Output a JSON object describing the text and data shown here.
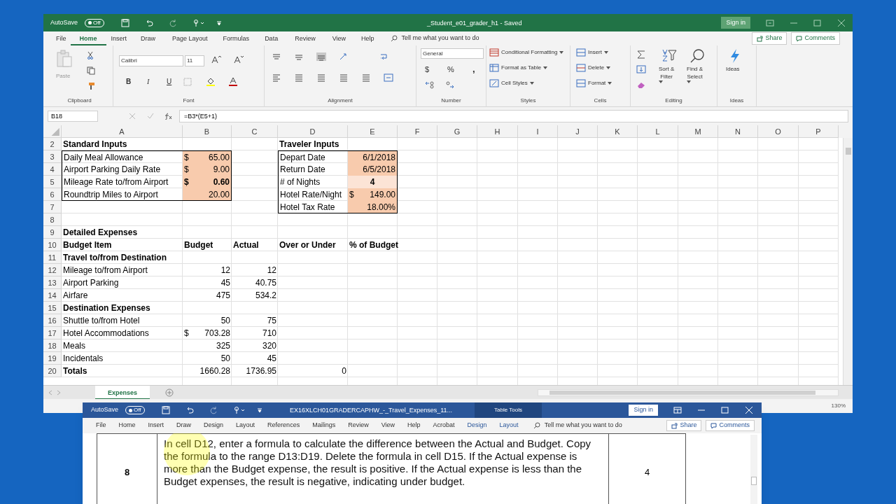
{
  "excel": {
    "title_bar": {
      "autosave_label": "AutoSave",
      "autosave": {
        "label": "Off",
        "on": false
      },
      "title": "_Student_e01_grader_h1  -  Saved",
      "sign_in": "Sign in"
    },
    "tabs": [
      {
        "label": "File",
        "selected": false
      },
      {
        "label": "Home",
        "selected": true
      },
      {
        "label": "Insert",
        "selected": false
      },
      {
        "label": "Draw",
        "selected": false
      },
      {
        "label": "Page Layout",
        "selected": false
      },
      {
        "label": "Formulas",
        "selected": false
      },
      {
        "label": "Data",
        "selected": false
      },
      {
        "label": "Review",
        "selected": false
      },
      {
        "label": "View",
        "selected": false
      },
      {
        "label": "Help",
        "selected": false
      }
    ],
    "tell_me": "Tell me what you want to do",
    "share": "Share",
    "comments": "Comments",
    "ribbon": {
      "paste": "Paste",
      "font_name": "Calibri",
      "font_size": "11",
      "bold": "B",
      "italic": "I",
      "underline": "U",
      "number_format": "General",
      "currency": "$",
      "percent": "%",
      "comma": ",",
      "styles": [
        "Conditional Formatting",
        "Format as Table",
        "Cell Styles"
      ],
      "cells": [
        "Insert",
        "Delete",
        "Format"
      ],
      "sort": [
        "Sort &",
        "Filter"
      ],
      "find": [
        "Find &",
        "Select"
      ],
      "ideas": "Ideas",
      "groups": [
        "Clipboard",
        "Font",
        "Alignment",
        "Number",
        "Styles",
        "Cells",
        "Editing",
        "Ideas"
      ]
    },
    "formula_bar": {
      "name_box": "B18",
      "formula": "=B3*(E5+1)"
    },
    "grid": {
      "columns": [
        "A",
        "B",
        "C",
        "D",
        "E",
        "F",
        "G",
        "H",
        "I",
        "J",
        "K",
        "L",
        "M",
        "N",
        "O",
        "P"
      ],
      "rows": [
        {
          "number": "2",
          "cells": [
            {
              "text": "Standard Inputs",
              "kind": "label",
              "bold": true
            },
            "",
            "",
            {
              "text": "Traveler Inputs",
              "kind": "label",
              "bold": true
            }
          ]
        },
        {
          "number": "3",
          "cells": [
            {
              "text": "Daily Meal Allowance",
              "kind": "label",
              "framed": true
            },
            {
              "symbol": "$",
              "text": "65.00",
              "kind": "number",
              "color": "#f8cbad",
              "framed": true
            },
            "",
            {
              "text": "Depart Date",
              "kind": "label",
              "framed": true
            },
            {
              "text": "6/1/2018",
              "kind": "number",
              "color": "#f8cbad",
              "framed": true
            }
          ]
        },
        {
          "number": "4",
          "cells": [
            {
              "text": "Airport Parking Daily Rate",
              "kind": "label",
              "framed": true
            },
            {
              "symbol": "$",
              "text": "9.00",
              "kind": "number",
              "color": "#f8cbad",
              "framed": true
            },
            "",
            {
              "text": "Return Date",
              "kind": "label",
              "framed": true
            },
            {
              "text": "6/5/2018",
              "kind": "number",
              "color": "#f8cbad",
              "framed": true
            }
          ]
        },
        {
          "number": "5",
          "cells": [
            {
              "text": "Mileage Rate to/from Airport",
              "kind": "label",
              "framed": true
            },
            {
              "symbol": "$",
              "text": "0.60",
              "kind": "number",
              "bold": true,
              "color": "#f8cbad",
              "framed": true
            },
            "",
            {
              "text": "# of Nights",
              "kind": "label",
              "framed": true
            },
            {
              "text": "4",
              "kind": "centered",
              "bold": true,
              "color": "#fce4d6",
              "framed": true
            }
          ]
        },
        {
          "number": "6",
          "cells": [
            {
              "text": "Roundtrip Miles to Airport",
              "kind": "label",
              "framed": true
            },
            {
              "text": "20.00",
              "kind": "number",
              "color": "#f8cbad",
              "framed": true
            },
            "",
            {
              "text": "Hotel Rate/Night",
              "kind": "label",
              "framed": true
            },
            {
              "symbol": "$",
              "text": "149.00",
              "kind": "number",
              "color": "#f8cbad",
              "framed": true
            }
          ]
        },
        {
          "number": "7",
          "cells": [
            "",
            "",
            "",
            {
              "text": "Hotel Tax Rate",
              "kind": "label",
              "framed": true
            },
            {
              "text": "18.00%",
              "kind": "number",
              "color": "#f8cbad",
              "framed": true
            }
          ]
        },
        {
          "number": "8",
          "cells": []
        },
        {
          "number": "9",
          "cells": [
            {
              "text": "Detailed Expenses",
              "kind": "label",
              "bold": true
            }
          ]
        },
        {
          "number": "10",
          "cells": [
            {
              "text": "Budget Item",
              "kind": "label",
              "bold": true
            },
            {
              "text": "Budget",
              "kind": "label",
              "bold": true
            },
            {
              "text": "Actual",
              "kind": "label",
              "bold": true
            },
            {
              "text": "Over or Under",
              "kind": "label",
              "bold": true
            },
            {
              "text": "% of Budget",
              "kind": "label",
              "bold": true
            }
          ]
        },
        {
          "number": "11",
          "cells": [
            {
              "text": "Travel to/from Destination",
              "kind": "label",
              "bold": true
            }
          ]
        },
        {
          "number": "12",
          "cells": [
            {
              "text": "Mileage to/from Airport",
              "kind": "label"
            },
            {
              "text": "12",
              "kind": "number"
            },
            {
              "text": "12",
              "kind": "number"
            }
          ]
        },
        {
          "number": "13",
          "cells": [
            {
              "text": "Airport Parking",
              "kind": "label"
            },
            {
              "text": "45",
              "kind": "number"
            },
            {
              "text": "40.75",
              "kind": "number"
            }
          ]
        },
        {
          "number": "14",
          "cells": [
            {
              "text": "Airfare",
              "kind": "label"
            },
            {
              "text": "475",
              "kind": "number"
            },
            {
              "text": "534.2",
              "kind": "number"
            }
          ]
        },
        {
          "number": "15",
          "cells": [
            {
              "text": "Destination Expenses",
              "kind": "label",
              "bold": true
            }
          ]
        },
        {
          "number": "16",
          "cells": [
            {
              "text": "Shuttle to/from Hotel",
              "kind": "label"
            },
            {
              "text": "50",
              "kind": "number"
            },
            {
              "text": "75",
              "kind": "number"
            }
          ]
        },
        {
          "number": "17",
          "cells": [
            {
              "text": "Hotel Accommodations",
              "kind": "label"
            },
            {
              "symbol": "$",
              "text": "703.28",
              "kind": "number"
            },
            {
              "text": "710",
              "kind": "number"
            }
          ]
        },
        {
          "number": "18",
          "cells": [
            {
              "text": "Meals",
              "kind": "label"
            },
            {
              "text": "325",
              "kind": "number"
            },
            {
              "text": "320",
              "kind": "number"
            }
          ]
        },
        {
          "number": "19",
          "cells": [
            {
              "text": "Incidentals",
              "kind": "label"
            },
            {
              "text": "50",
              "kind": "number"
            },
            {
              "text": "45",
              "kind": "number"
            }
          ]
        },
        {
          "number": "20",
          "cells": [
            {
              "text": "Totals",
              "kind": "label",
              "bold": true
            },
            {
              "text": "1660.28",
              "kind": "number"
            },
            {
              "text": "1736.95",
              "kind": "number"
            },
            {
              "text": "0",
              "kind": "number"
            }
          ]
        }
      ]
    },
    "sheet_tabs": [
      {
        "label": "Expenses",
        "selected": true
      }
    ],
    "status_bar": {
      "zoom": "130%"
    }
  },
  "word": {
    "title_bar": {
      "autosave_label": "AutoSave",
      "autosave": {
        "label": "Off",
        "on": false
      },
      "title": "EX16XLCH01GRADERCAPHW_-_Travel_Expenses_11...",
      "context": "Table Tools",
      "sign_in": "Sign in"
    },
    "tabs": [
      {
        "label": "File",
        "contextual": false
      },
      {
        "label": "Home",
        "contextual": false
      },
      {
        "label": "Insert",
        "contextual": false
      },
      {
        "label": "Draw",
        "contextual": false
      },
      {
        "label": "Design",
        "contextual": false
      },
      {
        "label": "Layout",
        "contextual": false
      },
      {
        "label": "References",
        "contextual": false
      },
      {
        "label": "Mailings",
        "contextual": false
      },
      {
        "label": "Review",
        "contextual": false
      },
      {
        "label": "View",
        "contextual": false
      },
      {
        "label": "Help",
        "contextual": false
      },
      {
        "label": "Acrobat",
        "contextual": false
      },
      {
        "label": "Design",
        "contextual": true
      },
      {
        "label": "Layout",
        "contextual": true
      }
    ],
    "tell_me": "Tell me what you want to do",
    "share": "Share",
    "comments": "Comments",
    "table_row": {
      "step": "8",
      "instruction": "In cell D12, enter a formula to calculate the difference between the Actual and Budget. Copy the formula to the range D13:D19. Delete the formula in cell D15. If the Actual expense is more than the Budget expense, the result is positive. If the Actual expense is less than the Budget expenses, the result is negative, indicating under budget.",
      "points": "4"
    }
  }
}
